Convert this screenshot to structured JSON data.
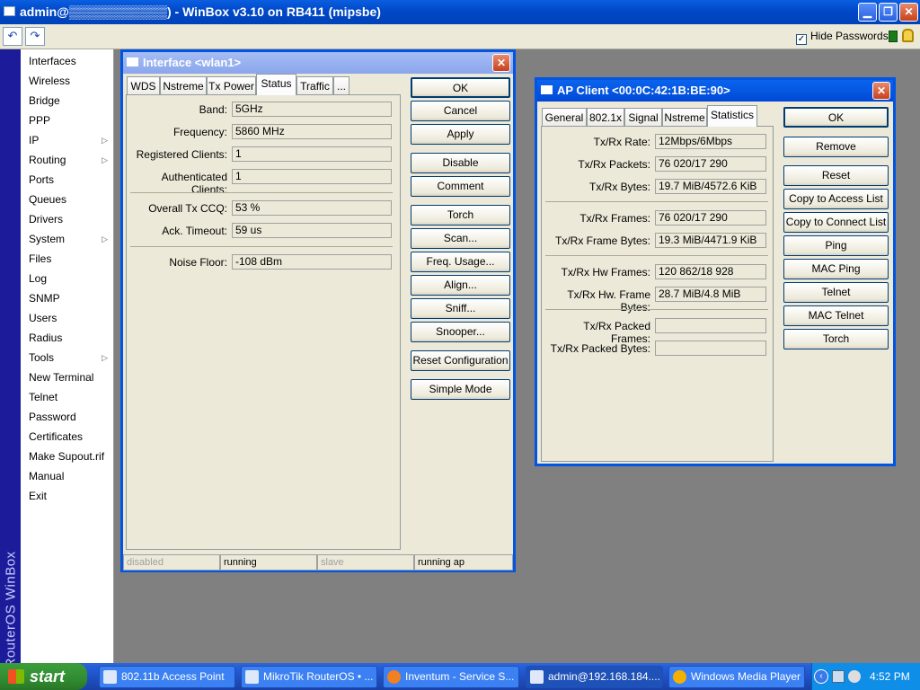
{
  "window": {
    "title": "admin@▒▒▒▒▒▒▒▒▒▒▒) - WinBox v3.10 on RB411 (mipsbe)"
  },
  "toolbar": {
    "undo_icon": "undo-icon",
    "redo_icon": "redo-icon",
    "hide_passwords_label": "Hide Passwords",
    "hide_passwords_checked": true
  },
  "sidebar": {
    "brand": "RouterOS WinBox",
    "items": [
      {
        "label": "Interfaces"
      },
      {
        "label": "Wireless"
      },
      {
        "label": "Bridge"
      },
      {
        "label": "PPP"
      },
      {
        "label": "IP",
        "submenu": true
      },
      {
        "label": "Routing",
        "submenu": true
      },
      {
        "label": "Ports"
      },
      {
        "label": "Queues"
      },
      {
        "label": "Drivers"
      },
      {
        "label": "System",
        "submenu": true
      },
      {
        "label": "Files"
      },
      {
        "label": "Log"
      },
      {
        "label": "SNMP"
      },
      {
        "label": "Users"
      },
      {
        "label": "Radius"
      },
      {
        "label": "Tools",
        "submenu": true
      },
      {
        "label": "New Terminal"
      },
      {
        "label": "Telnet"
      },
      {
        "label": "Password"
      },
      {
        "label": "Certificates"
      },
      {
        "label": "Make Supout.rif"
      },
      {
        "label": "Manual"
      },
      {
        "label": "Exit"
      }
    ]
  },
  "interface_dialog": {
    "title": "Interface <wlan1>",
    "tabs": [
      "WDS",
      "Nstreme",
      "Tx Power",
      "Status",
      "Traffic",
      "..."
    ],
    "active_tab": "Status",
    "fields": {
      "band": {
        "label": "Band:",
        "value": "5GHz"
      },
      "frequency": {
        "label": "Frequency:",
        "value": "5860 MHz"
      },
      "registered": {
        "label": "Registered Clients:",
        "value": "1"
      },
      "authenticated": {
        "label": "Authenticated Clients:",
        "value": "1"
      },
      "ccq": {
        "label": "Overall Tx CCQ:",
        "value": "53 %"
      },
      "ack": {
        "label": "Ack. Timeout:",
        "value": "59 us"
      },
      "noise": {
        "label": "Noise Floor:",
        "value": "-108 dBm"
      }
    },
    "buttons": {
      "ok": "OK",
      "cancel": "Cancel",
      "apply": "Apply",
      "disable": "Disable",
      "comment": "Comment",
      "torch": "Torch",
      "scan": "Scan...",
      "freq_usage": "Freq. Usage...",
      "align": "Align...",
      "sniff": "Sniff...",
      "snooper": "Snooper...",
      "reset_config": "Reset Configuration",
      "simple_mode": "Simple Mode"
    },
    "status": [
      "disabled",
      "running",
      "slave",
      "running ap"
    ]
  },
  "ap_dialog": {
    "title": "AP Client <00:0C:42:1B:BE:90>",
    "tabs": [
      "General",
      "802.1x",
      "Signal",
      "Nstreme",
      "Statistics"
    ],
    "active_tab": "Statistics",
    "fields": {
      "rate": {
        "label": "Tx/Rx Rate:",
        "value": "12Mbps/6Mbps"
      },
      "packets": {
        "label": "Tx/Rx Packets:",
        "value": "76 020/17 290"
      },
      "bytes": {
        "label": "Tx/Rx Bytes:",
        "value": "19.7 MiB/4572.6 KiB"
      },
      "frames": {
        "label": "Tx/Rx Frames:",
        "value": "76 020/17 290"
      },
      "frame_bytes": {
        "label": "Tx/Rx Frame Bytes:",
        "value": "19.3 MiB/4471.9 KiB"
      },
      "hw_frames": {
        "label": "Tx/Rx Hw Frames:",
        "value": "120 862/18 928"
      },
      "hw_frame_bytes": {
        "label": "Tx/Rx Hw. Frame Bytes:",
        "value": "28.7 MiB/4.8 MiB"
      },
      "packed_frames": {
        "label": "Tx/Rx Packed Frames:",
        "value": ""
      },
      "packed_bytes": {
        "label": "Tx/Rx Packed Bytes:",
        "value": ""
      }
    },
    "buttons": {
      "ok": "OK",
      "remove": "Remove",
      "reset": "Reset",
      "copy_access": "Copy to Access List",
      "copy_connect": "Copy to Connect List",
      "ping": "Ping",
      "mac_ping": "MAC Ping",
      "telnet": "Telnet",
      "mac_telnet": "MAC Telnet",
      "torch": "Torch"
    }
  },
  "taskbar": {
    "start": "start",
    "tasks": [
      "802.11b Access Point",
      "MikroTik RouterOS • ...",
      "Inventum - Service S...",
      "admin@192.168.184....",
      "Windows Media Player"
    ],
    "clock": "4:52 PM"
  }
}
